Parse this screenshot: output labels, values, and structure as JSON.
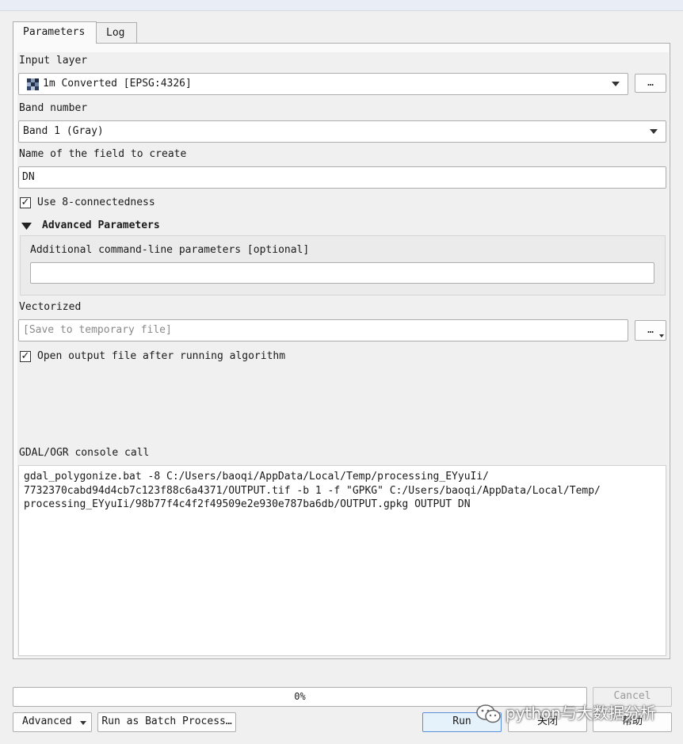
{
  "tabs": [
    {
      "label": "Parameters"
    },
    {
      "label": "Log"
    }
  ],
  "input_layer": {
    "label": "Input layer",
    "value": "1m Converted [EPSG:4326]",
    "browse_label": "…"
  },
  "band_number": {
    "label": "Band number",
    "value": "Band 1 (Gray)"
  },
  "field_name": {
    "label": "Name of the field to create",
    "value": "DN"
  },
  "connectedness": {
    "label": "Use 8-connectedness",
    "checked": true,
    "mark": "✓"
  },
  "advanced_params": {
    "header": "Advanced Parameters",
    "extra_label": "Additional command-line parameters [optional]",
    "extra_value": ""
  },
  "vectorized": {
    "label": "Vectorized",
    "placeholder": "[Save to temporary file]",
    "browse_label": "…"
  },
  "open_output": {
    "label": "Open output file after running algorithm",
    "checked": true,
    "mark": "✓"
  },
  "console": {
    "label": "GDAL/OGR console call",
    "text": "gdal_polygonize.bat -8 C:/Users/baoqi/AppData/Local/Temp/processing_EYyuIi/\n7732370cabd94d4cb7c123f88c6a4371/OUTPUT.tif -b 1 -f \"GPKG\" C:/Users/baoqi/AppData/Local/Temp/\nprocessing_EYyuIi/98b77f4c4f2f49509e2e930e787ba6db/OUTPUT.gpkg OUTPUT DN"
  },
  "progress": {
    "value": 0,
    "text": "0%"
  },
  "buttons": {
    "cancel": "Cancel",
    "advanced": "Advanced",
    "batch": "Run as Batch Process…",
    "run": "Run",
    "close": "关闭",
    "help": "帮助"
  },
  "watermark": {
    "text": "python与大数据分析"
  },
  "icons": {
    "raster_layer": "raster-layer-icon",
    "dropdown": "chevron-down-icon",
    "collapse": "triangle-down-icon",
    "wechat": "wechat-icon"
  }
}
